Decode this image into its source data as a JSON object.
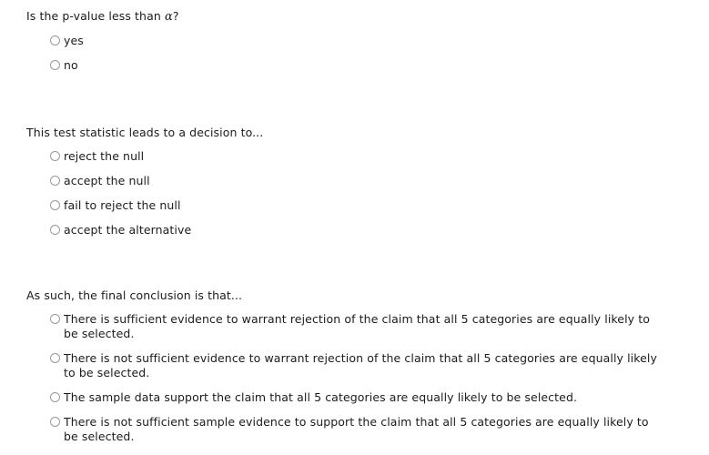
{
  "form": {
    "questions": [
      {
        "id": "p-value-comparison",
        "prompt_prefix": "Is the p-value less than ",
        "prompt_symbol": "α",
        "prompt_suffix": "?",
        "options": [
          {
            "label": "yes"
          },
          {
            "label": "no"
          }
        ]
      },
      {
        "id": "decision",
        "prompt": "This test statistic leads to a decision to...",
        "options": [
          {
            "label": "reject the null"
          },
          {
            "label": "accept the null"
          },
          {
            "label": "fail to reject the null"
          },
          {
            "label": "accept the alternative"
          }
        ]
      },
      {
        "id": "final-conclusion",
        "prompt": "As such, the final conclusion is that...",
        "options": [
          {
            "label": "There is sufficient evidence to warrant rejection of the claim that all 5 categories are equally likely to be selected."
          },
          {
            "label": "There is not sufficient evidence to warrant rejection of the claim that all 5 categories are equally likely to be selected."
          },
          {
            "label": "The sample data support the claim that all 5 categories are equally likely to be selected."
          },
          {
            "label": "There is not sufficient sample evidence to support the claim that all 5 categories are equally likely to be selected."
          }
        ]
      }
    ]
  }
}
